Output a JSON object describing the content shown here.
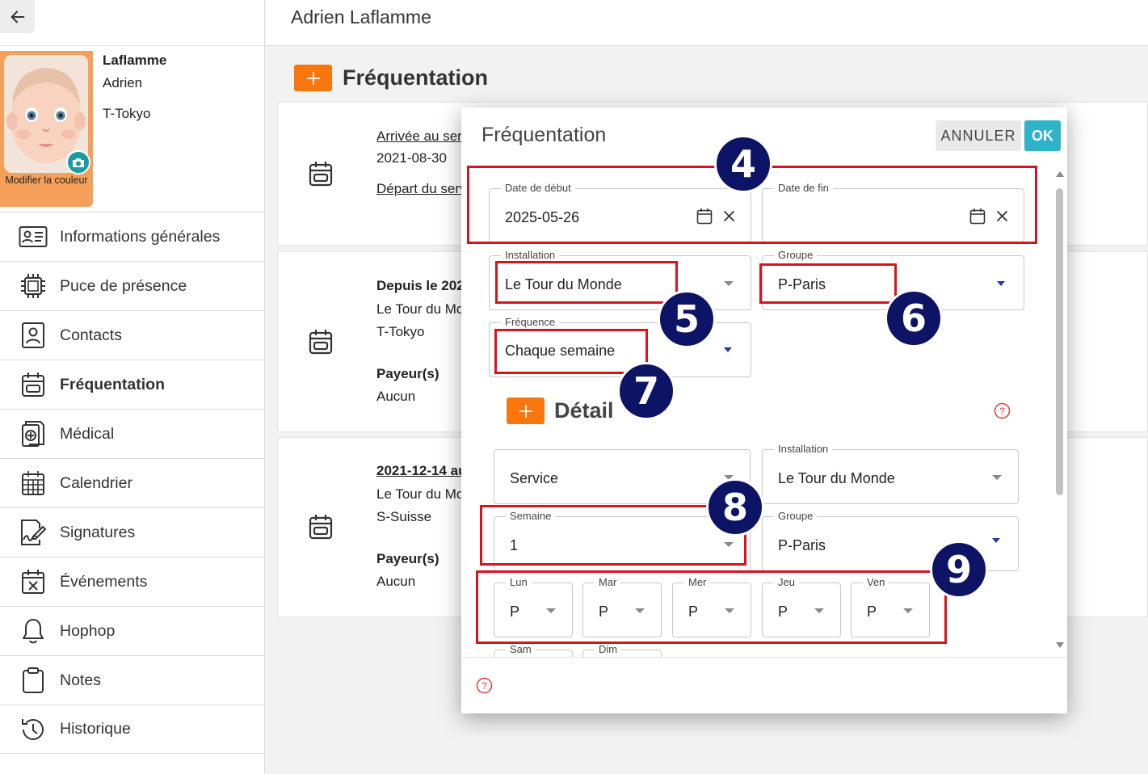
{
  "profile": {
    "last_name": "Laflamme",
    "first_name": "Adrien",
    "group": "T-Tokyo",
    "photo_caption": "Modifier la couleur"
  },
  "nav": {
    "items": [
      {
        "label": "Informations générales",
        "icon": "id-card-icon"
      },
      {
        "label": "Puce de présence",
        "icon": "chip-icon"
      },
      {
        "label": "Contacts",
        "icon": "contact-icon"
      },
      {
        "label": "Fréquentation",
        "icon": "calendar-icon",
        "active": true
      },
      {
        "label": "Médical",
        "icon": "medical-icon"
      },
      {
        "label": "Calendrier",
        "icon": "calendar-grid-icon"
      },
      {
        "label": "Signatures",
        "icon": "signature-icon"
      },
      {
        "label": "Événements",
        "icon": "event-icon"
      },
      {
        "label": "Hophop",
        "icon": "bell-icon"
      },
      {
        "label": "Notes",
        "icon": "clipboard-icon"
      },
      {
        "label": "Historique",
        "icon": "history-icon"
      }
    ]
  },
  "header": {
    "title": "Adrien Laflamme"
  },
  "section": {
    "title": "Fréquentation"
  },
  "cards": [
    {
      "arrival_label": "Arrivée au serv",
      "arrival_date": "2021-08-30",
      "departure_label": "Départ du serv"
    },
    {
      "since": "Depuis le 202",
      "installation": "Le Tour du Mo",
      "group": "T-Tokyo",
      "payer_label": "Payeur(s)",
      "payer": "Aucun"
    },
    {
      "period": "2021-12-14 au",
      "installation": "Le Tour du Mo",
      "group": "S-Suisse",
      "payer_label": "Payeur(s)",
      "payer": "Aucun"
    }
  ],
  "dialog": {
    "title": "Fréquentation",
    "cancel": "ANNULER",
    "ok": "OK",
    "start_date": {
      "label": "Date de début",
      "value": "2025-05-26"
    },
    "end_date": {
      "label": "Date de fin",
      "value": ""
    },
    "installation": {
      "label": "Installation",
      "value": "Le Tour du Monde"
    },
    "group": {
      "label": "Groupe",
      "value": "P-Paris"
    },
    "frequency": {
      "label": "Fréquence",
      "value": "Chaque semaine"
    },
    "detail": {
      "title": "Détail",
      "service": {
        "value": "Service"
      },
      "installation": {
        "label": "Installation",
        "value": "Le Tour du Monde"
      },
      "week": {
        "label": "Semaine",
        "value": "1"
      },
      "group": {
        "label": "Groupe",
        "value": "P-Paris"
      },
      "days": [
        {
          "label": "Lun",
          "value": "P"
        },
        {
          "label": "Mar",
          "value": "P"
        },
        {
          "label": "Mer",
          "value": "P"
        },
        {
          "label": "Jeu",
          "value": "P"
        },
        {
          "label": "Ven",
          "value": "P"
        }
      ],
      "weekend": [
        {
          "label": "Sam"
        },
        {
          "label": "Dim"
        }
      ]
    }
  },
  "annotations": [
    "4",
    "5",
    "6",
    "7",
    "8",
    "9"
  ],
  "colors": {
    "accent": "#f7760e",
    "ok": "#2eb3c9",
    "highlight": "#d9121f",
    "badge": "#0d1466"
  }
}
